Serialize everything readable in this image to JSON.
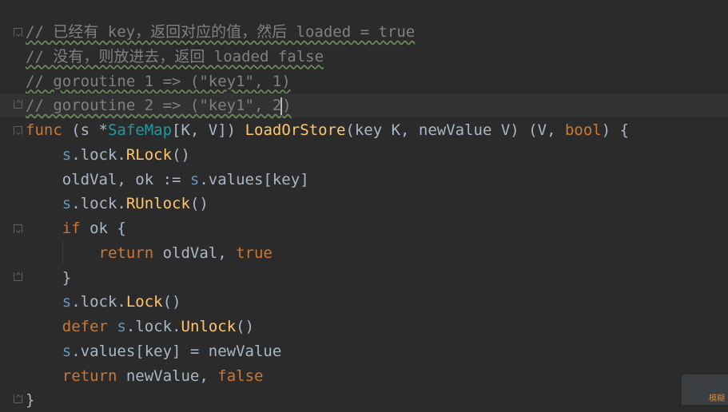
{
  "editor": {
    "lines": [
      {
        "tokens": [
          {
            "c": "cm",
            "t": "// 已经有 key，返回对应的值，然后 loaded = true"
          }
        ]
      },
      {
        "tokens": [
          {
            "c": "cm",
            "t": "// 没有，则放进去，返回 loaded false"
          }
        ]
      },
      {
        "tokens": [
          {
            "c": "cm",
            "t": "// goroutine 1 => (\"key1\", 1)"
          }
        ]
      },
      {
        "tokens": [
          {
            "c": "cm",
            "t": "// goroutine 2 => (\"key1\", 2"
          }
        ]
      },
      {
        "tokens": [
          {
            "c": "kw",
            "t": "func"
          },
          {
            "c": "pl",
            "t": " (s *"
          },
          {
            "c": "ty",
            "t": "SafeMap"
          },
          {
            "c": "pl",
            "t": "[K, V]) "
          },
          {
            "c": "fn",
            "t": "LoadOrStore"
          },
          {
            "c": "pl",
            "t": "(key K, newValue V) (V, "
          },
          {
            "c": "kw",
            "t": "bool"
          },
          {
            "c": "pl",
            "t": ") {"
          }
        ]
      },
      {
        "tokens": [
          {
            "c": "pl",
            "t": "    "
          },
          {
            "c": "recv",
            "t": "s"
          },
          {
            "c": "pl",
            "t": ".lock."
          },
          {
            "c": "mth",
            "t": "RLock"
          },
          {
            "c": "pl",
            "t": "()"
          }
        ]
      },
      {
        "tokens": [
          {
            "c": "pl",
            "t": "    oldVal, ok := "
          },
          {
            "c": "recv",
            "t": "s"
          },
          {
            "c": "pl",
            "t": ".values[key]"
          }
        ]
      },
      {
        "tokens": [
          {
            "c": "pl",
            "t": "    "
          },
          {
            "c": "recv",
            "t": "s"
          },
          {
            "c": "pl",
            "t": ".lock."
          },
          {
            "c": "mth",
            "t": "RUnlock"
          },
          {
            "c": "pl",
            "t": "()"
          }
        ]
      },
      {
        "tokens": [
          {
            "c": "pl",
            "t": "    "
          },
          {
            "c": "kw",
            "t": "if"
          },
          {
            "c": "pl",
            "t": " ok {"
          }
        ]
      },
      {
        "tokens": [
          {
            "c": "pl",
            "t": "        "
          },
          {
            "c": "kw",
            "t": "return"
          },
          {
            "c": "pl",
            "t": " oldVal, "
          },
          {
            "c": "kw",
            "t": "true"
          }
        ]
      },
      {
        "tokens": [
          {
            "c": "pl",
            "t": "    }"
          }
        ]
      },
      {
        "tokens": [
          {
            "c": "pl",
            "t": "    "
          },
          {
            "c": "recv",
            "t": "s"
          },
          {
            "c": "pl",
            "t": ".lock."
          },
          {
            "c": "mth",
            "t": "Lock"
          },
          {
            "c": "pl",
            "t": "()"
          }
        ]
      },
      {
        "tokens": [
          {
            "c": "pl",
            "t": "    "
          },
          {
            "c": "kw",
            "t": "defer"
          },
          {
            "c": "pl",
            "t": " "
          },
          {
            "c": "recv",
            "t": "s"
          },
          {
            "c": "pl",
            "t": ".lock."
          },
          {
            "c": "mth",
            "t": "Unlock"
          },
          {
            "c": "pl",
            "t": "()"
          }
        ]
      },
      {
        "tokens": [
          {
            "c": "pl",
            "t": "    "
          },
          {
            "c": "recv",
            "t": "s"
          },
          {
            "c": "pl",
            "t": ".values[key] = newValue"
          }
        ]
      },
      {
        "tokens": [
          {
            "c": "pl",
            "t": "    "
          },
          {
            "c": "kw",
            "t": "return"
          },
          {
            "c": "pl",
            "t": " newValue, "
          },
          {
            "c": "kw",
            "t": "false"
          }
        ]
      },
      {
        "tokens": [
          {
            "c": "pl",
            "t": "}"
          }
        ]
      }
    ],
    "current_line": 3,
    "closing_paren": ")",
    "folds": [
      {
        "line": 0,
        "kind": "up-icon"
      },
      {
        "line": 3,
        "kind": "down-icon"
      },
      {
        "line": 4,
        "kind": "up-icon"
      },
      {
        "line": 8,
        "kind": "up-icon"
      },
      {
        "line": 10,
        "kind": "down-icon"
      },
      {
        "line": 15,
        "kind": "down-icon"
      }
    ]
  },
  "overlay": {
    "text": "模糊"
  },
  "colors": {
    "background": "#2b2b2b",
    "keyword": "#cc7832",
    "function": "#ffc66d",
    "type": "#20999d",
    "comment": "#808080",
    "plain": "#a9b7c6"
  }
}
